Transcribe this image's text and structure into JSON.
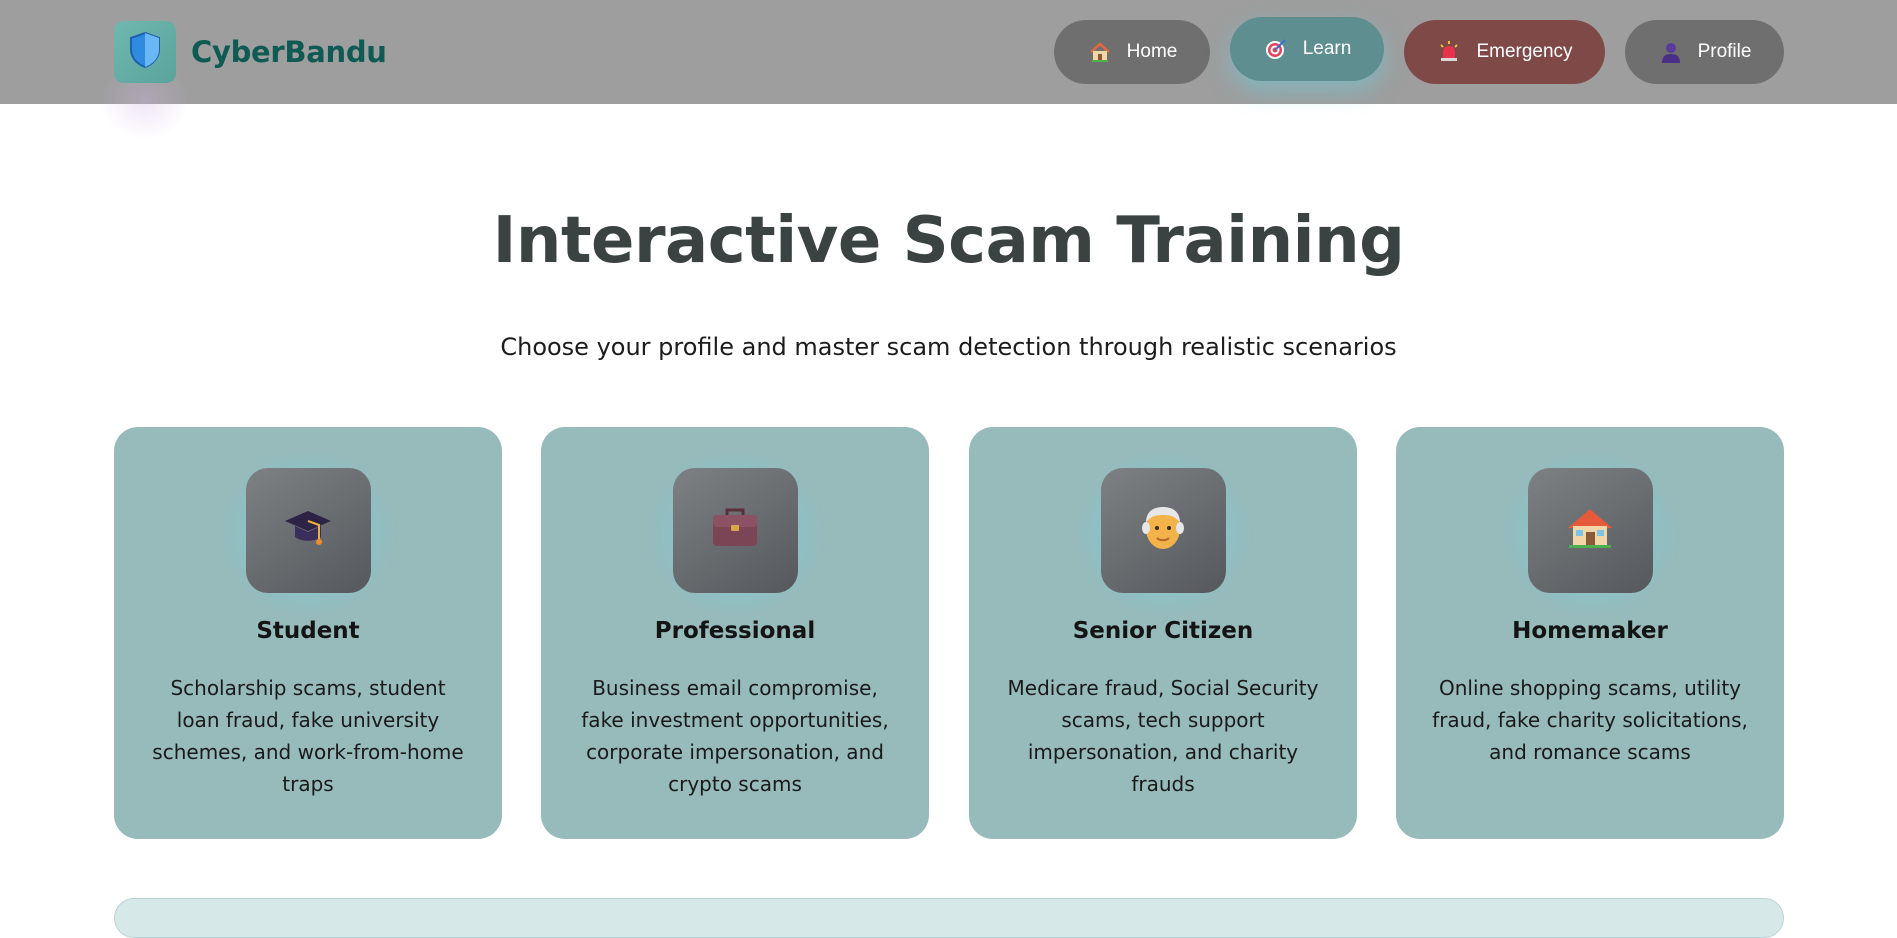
{
  "brand": {
    "name": "CyberBandu",
    "logo_icon": "shield-icon"
  },
  "nav": {
    "items": [
      {
        "label": "Home",
        "icon": "house-icon"
      },
      {
        "label": "Learn",
        "icon": "target-icon",
        "active": true
      },
      {
        "label": "Emergency",
        "icon": "siren-icon"
      },
      {
        "label": "Profile",
        "icon": "person-icon"
      }
    ]
  },
  "hero": {
    "title": "Interactive Scam Training",
    "subtitle": "Choose your profile and master scam detection through realistic scenarios"
  },
  "profiles": [
    {
      "title": "Student",
      "icon": "graduation-cap-icon",
      "description": "Scholarship scams, student loan fraud, fake university schemes, and work-from-home traps"
    },
    {
      "title": "Professional",
      "icon": "briefcase-icon",
      "description": "Business email compromise, fake investment opportunities, corporate impersonation, and crypto scams"
    },
    {
      "title": "Senior Citizen",
      "icon": "old-man-icon",
      "description": "Medicare fraud, Social Security scams, tech support impersonation, and charity frauds"
    },
    {
      "title": "Homemaker",
      "icon": "house-icon",
      "description": "Online shopping scams, utility fraud, fake charity solicitations, and romance scams"
    }
  ],
  "colors": {
    "header_bg": "#9e9e9e",
    "brand_text": "#0f5a52",
    "card_bg": "#97baba",
    "active_nav": "#5f8e91",
    "emergency_nav": "#7f4948"
  }
}
